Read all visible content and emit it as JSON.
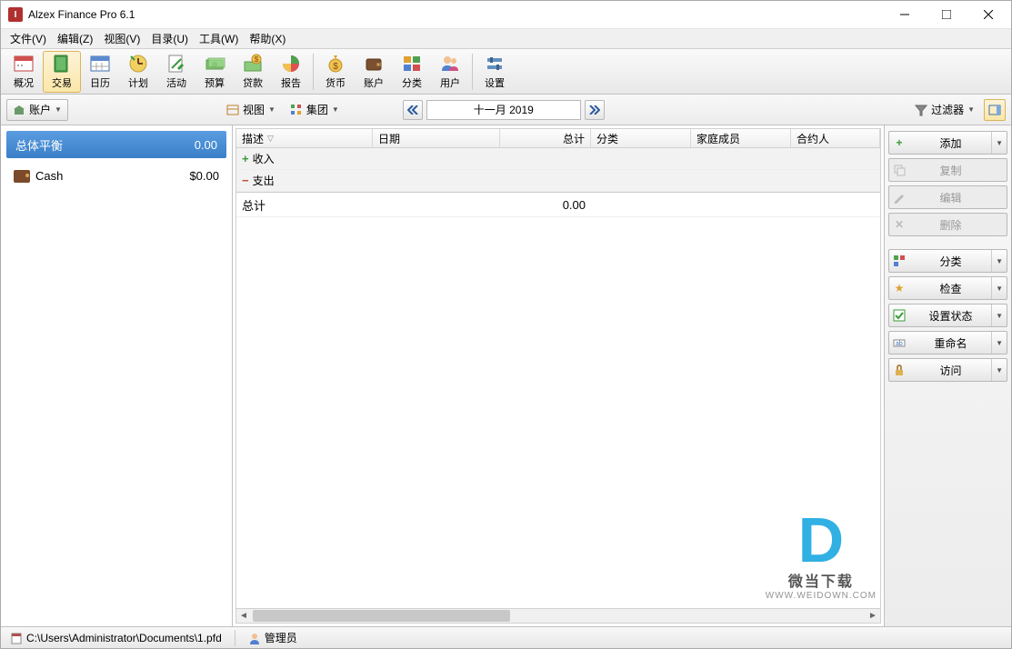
{
  "window": {
    "title": "Alzex Finance Pro 6.1"
  },
  "menu": {
    "file": "文件(V)",
    "edit": "编辑(Z)",
    "view": "视图(V)",
    "catalog": "目录(U)",
    "tools": "工具(W)",
    "help": "帮助(X)"
  },
  "toolbar": {
    "overview": "概况",
    "transaction": "交易",
    "calendar": "日历",
    "plan": "计划",
    "activity": "活动",
    "budget": "预算",
    "loan": "贷款",
    "report": "报告",
    "currency": "货币",
    "account": "账户",
    "category": "分类",
    "user": "用户",
    "settings": "设置"
  },
  "secondary": {
    "account_btn": "账户",
    "view_btn": "视图",
    "group_btn": "集团",
    "filter_btn": "过滤器",
    "date": "十一月 2019"
  },
  "left": {
    "balance_label": "总体平衡",
    "balance_value": "0.00",
    "account_name": "Cash",
    "account_value": "$0.00"
  },
  "grid": {
    "headers": {
      "desc": "描述",
      "date": "日期",
      "total": "总计",
      "category": "分类",
      "family": "家庭成员",
      "payee": "合约人"
    },
    "income": "收入",
    "expense": "支出",
    "total_label": "总计",
    "total_value": "0.00"
  },
  "actions": {
    "add": "添加",
    "copy": "复制",
    "edit": "编辑",
    "delete": "删除",
    "category": "分类",
    "check": "检查",
    "setstatus": "设置状态",
    "rename": "重命名",
    "access": "访问"
  },
  "status": {
    "path": "C:\\Users\\Administrator\\Documents\\1.pfd",
    "admin": "管理员"
  },
  "watermark": {
    "t1": "微当下载",
    "t2": "WWW.WEIDOWN.COM"
  }
}
